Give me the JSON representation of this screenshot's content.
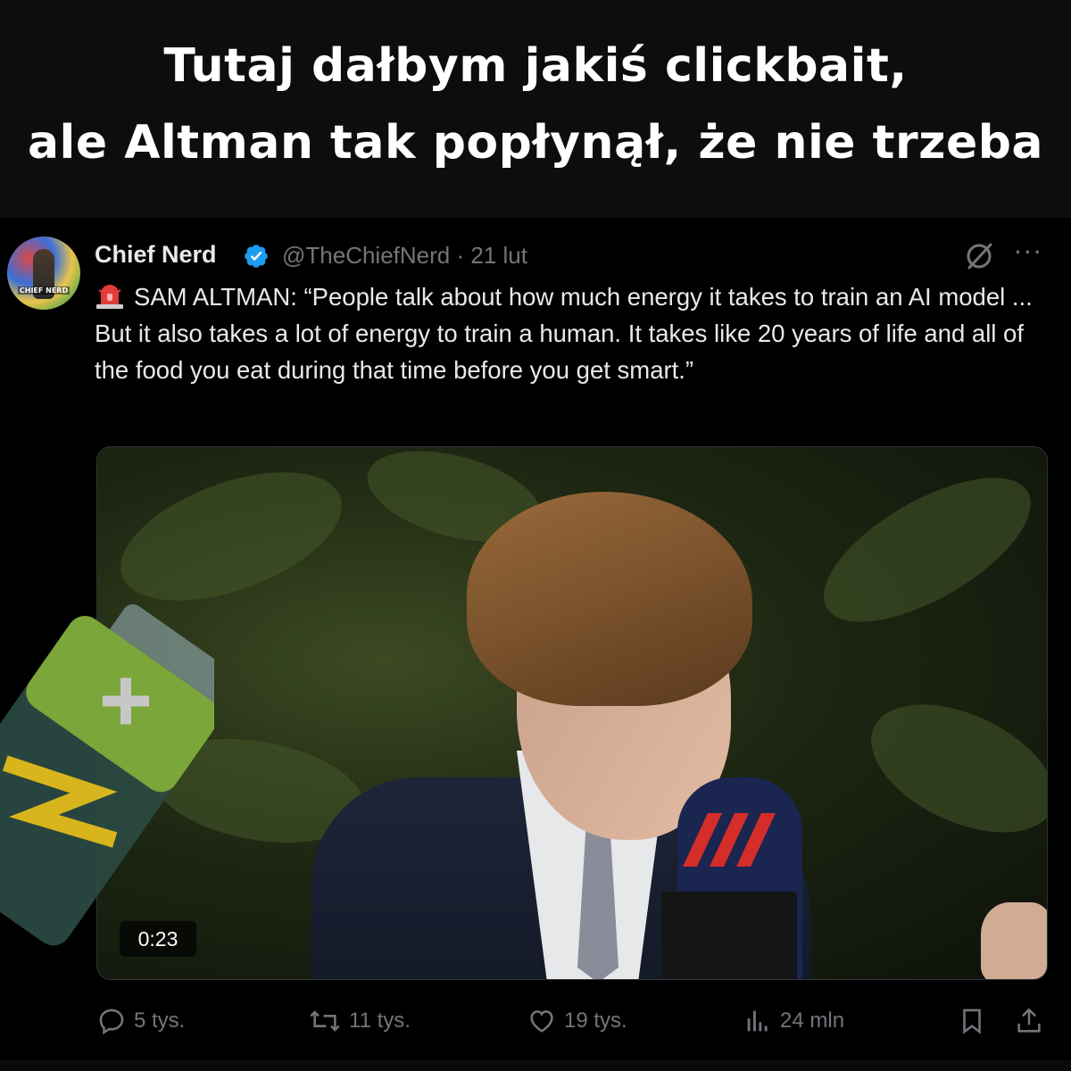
{
  "headline": {
    "line1": "Tutaj dałbym jakiś clickbait,",
    "line2": "ale Altman tak popłynął, że nie trzeba"
  },
  "tweet": {
    "author_name": "Chief Nerd",
    "avatar_label": "CHIEF NERD",
    "handle_and_time": "@TheChiefNerd · 21 lut",
    "text": "SAM ALTMAN: “People talk about how much energy it takes to train an AI model ... But it also takes a lot of energy to train a human. It takes like 20 years of life and all of the food you eat during that time before you get smart.”",
    "leading_icon": "siren-emoji",
    "verified_icon": "verified-badge-icon",
    "video_time": "0:23"
  },
  "actions": {
    "replies": "5 tys.",
    "reposts": "11 tys.",
    "likes": "19 tys.",
    "views": "24 mln"
  },
  "colors": {
    "background": "#000000",
    "text": "#e7e9ea",
    "muted": "#71767b",
    "verified": "#1d9bf0",
    "battery_green": "#7aa63a",
    "battery_bolt": "#d8b51c"
  }
}
